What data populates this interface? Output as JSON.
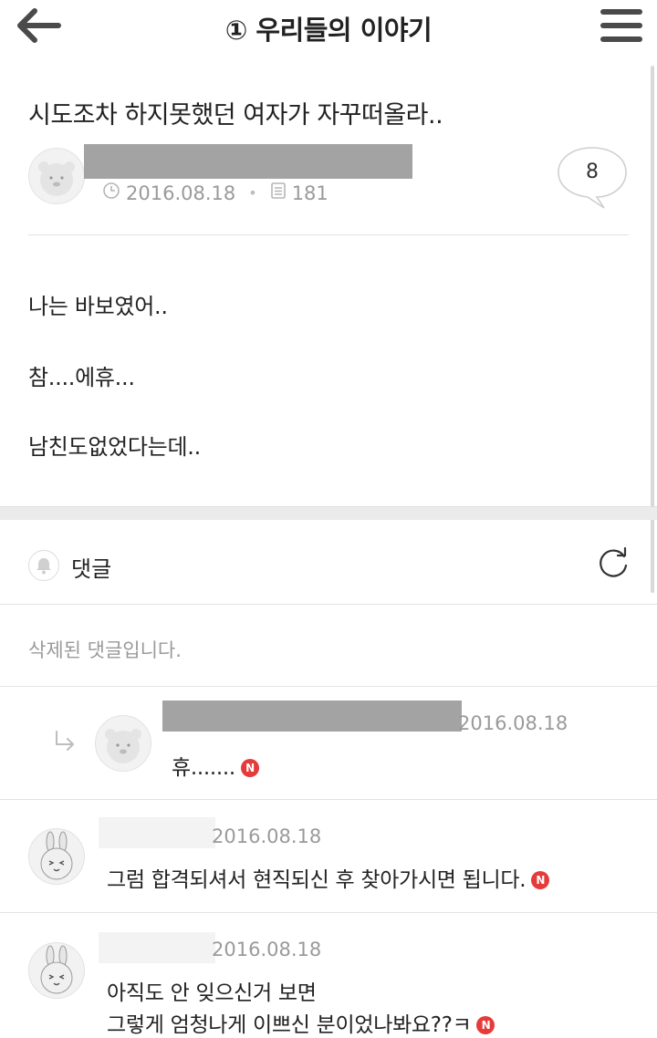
{
  "header": {
    "title": "① 우리들의 이야기",
    "back_icon": "arrow-left-icon",
    "menu_icon": "hamburger-menu-icon"
  },
  "post": {
    "title": "시도조차 하지못했던 여자가 자꾸떠올라..",
    "date": "2016.08.18",
    "views": "181",
    "comment_count": "8",
    "body": [
      "나는 바보였어..",
      "참....에휴...",
      "남친도없었다는데.."
    ]
  },
  "comments_section": {
    "label": "댓글",
    "deleted_text": "삭제된 댓글입니다.",
    "comments": [
      {
        "date": "2016.08.18",
        "text": "휴.......",
        "badge": "N",
        "is_reply": true
      },
      {
        "date": "2016.08.18",
        "text": "그럼 합격되셔서 현직되신 후 찾아가시면 됩니다.",
        "badge": "N",
        "is_reply": false
      },
      {
        "date": "2016.08.18",
        "lines": [
          "아직도 안 잊으신거 보면",
          "그렇게 엄청나게 이쁘신 분이었나봐요??ㅋ"
        ],
        "badge": "N",
        "is_reply": false
      }
    ]
  },
  "colors": {
    "badge_red": "#e53b3b",
    "meta_gray": "#9a9a9a",
    "divider": "#e3e3e3"
  }
}
